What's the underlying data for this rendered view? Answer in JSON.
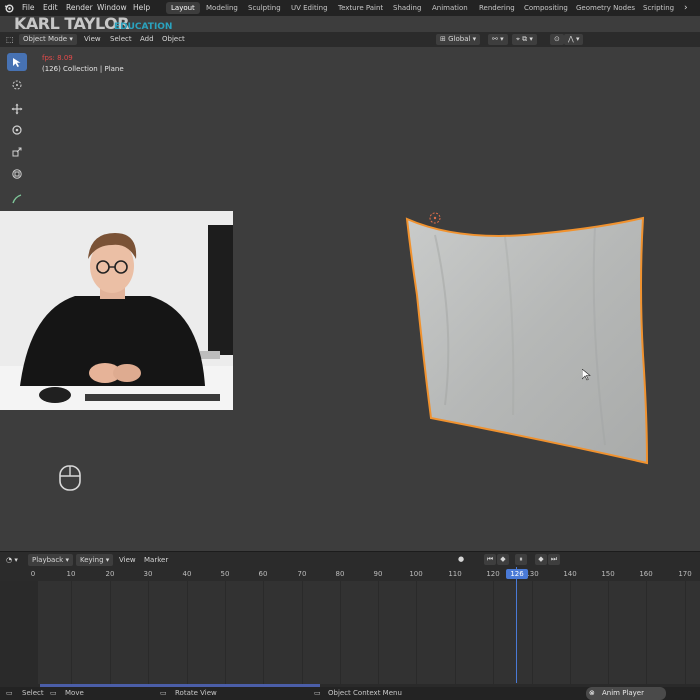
{
  "brand": {
    "name": "KARL TAYLOR",
    "sub": "EDUCATION"
  },
  "menu": [
    "File",
    "Edit",
    "Render",
    "Window",
    "Help"
  ],
  "workspaces": [
    "Layout",
    "Modeling",
    "Sculpting",
    "UV Editing",
    "Texture Paint",
    "Shading",
    "Animation",
    "Rendering",
    "Compositing",
    "Geometry Nodes",
    "Scripting"
  ],
  "active_workspace": "Layout",
  "header": {
    "mode": "Object Mode",
    "items": [
      "View",
      "Select",
      "Add",
      "Object"
    ],
    "transform_orientation": "Global"
  },
  "viewport": {
    "fps": "fps: 8.09",
    "collection": "(126) Collection | Plane"
  },
  "timeline": {
    "menus": [
      "Playback",
      "Keying",
      "View",
      "Marker"
    ],
    "ticks": [
      0,
      10,
      20,
      30,
      40,
      50,
      60,
      70,
      80,
      90,
      100,
      110,
      120,
      130,
      140,
      150,
      160,
      170
    ],
    "current_frame": "126"
  },
  "status": {
    "select": "Select",
    "move": "Move",
    "rotate": "Rotate View",
    "context": "Object Context Menu",
    "anim_player": "Anim Player"
  },
  "colors": {
    "accent": "#4772b3",
    "selection_outline": "#f0922f",
    "fps_text": "#e34a4a",
    "brand_edu": "#2aa3bf"
  }
}
